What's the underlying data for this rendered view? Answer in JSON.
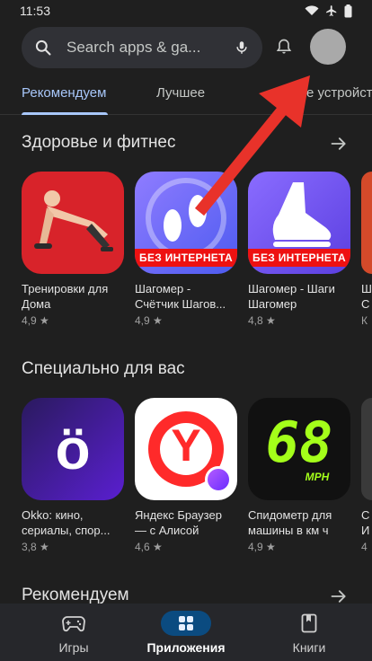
{
  "status_bar": {
    "time": "11:53"
  },
  "search": {
    "placeholder": "Search apps & ga..."
  },
  "tabs": [
    {
      "label": "Рекомендуем",
      "active": true
    },
    {
      "label": "Лучшее",
      "active": false
    },
    {
      "label": "е устройст",
      "active": false
    }
  ],
  "sections": [
    {
      "title": "Здоровье и фитнес",
      "apps": [
        {
          "name1": "Тренировки для",
          "name2": "Дома",
          "rating": "4,9 ★"
        },
        {
          "name1": "Шагомер -",
          "name2": "Счётчик Шагов...",
          "rating": "4,9 ★",
          "badge": "БЕЗ ИНТЕРНЕТА"
        },
        {
          "name1": "Шагомер - Шаги",
          "name2": "Шагомер",
          "rating": "4,8 ★",
          "badge": "БЕЗ ИНТЕРНЕТА"
        },
        {
          "name1": "Ш",
          "name2": "С",
          "rating": "К"
        }
      ]
    },
    {
      "title": "Специально для вас",
      "apps": [
        {
          "name1": "Okko: кино,",
          "name2": "сериалы, спор...",
          "rating": "3,8 ★",
          "logo": "ö"
        },
        {
          "name1": "Яндекс Браузер",
          "name2": "— с Алисой",
          "rating": "4,6 ★",
          "logo": "Y"
        },
        {
          "name1": "Спидометр для",
          "name2": "машины в км ч",
          "rating": "4,9 ★",
          "logo": "68",
          "sublogo": "MPH"
        },
        {
          "name1": "С",
          "name2": "И",
          "rating": "4"
        }
      ]
    },
    {
      "title": "Рекомендуем"
    }
  ],
  "bottom_nav": [
    {
      "label": "Игры",
      "icon": "gamepad-icon"
    },
    {
      "label": "Приложения",
      "icon": "apps-grid-icon",
      "active": true
    },
    {
      "label": "Книги",
      "icon": "book-icon"
    }
  ],
  "colors": {
    "background": "#1f1f1f",
    "accent": "#a8c7fa",
    "annotation_arrow": "#e8322a",
    "badge_red": "#ee1111"
  }
}
